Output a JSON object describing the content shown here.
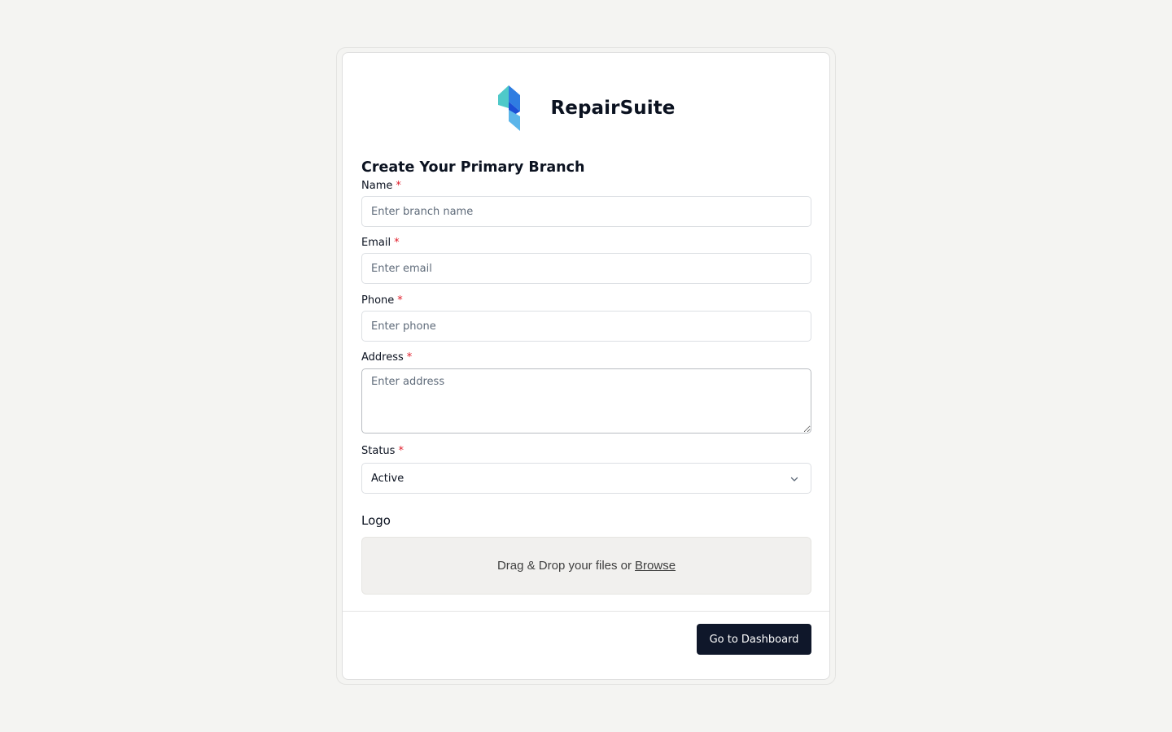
{
  "brand": {
    "name": "RepairSuite"
  },
  "form": {
    "title": "Create Your Primary Branch",
    "required_marker": "*",
    "fields": {
      "name": {
        "label": "Name",
        "placeholder": "Enter branch name",
        "value": ""
      },
      "email": {
        "label": "Email",
        "placeholder": "Enter email",
        "value": ""
      },
      "phone": {
        "label": "Phone",
        "placeholder": "Enter phone",
        "value": ""
      },
      "address": {
        "label": "Address",
        "placeholder": "Enter address",
        "value": ""
      },
      "status": {
        "label": "Status",
        "selected": "Active"
      }
    },
    "logo": {
      "heading": "Logo",
      "dropzone_text": "Drag & Drop your files or",
      "browse_label": "Browse"
    }
  },
  "footer": {
    "primary_button": "Go to Dashboard"
  },
  "icons": {
    "brand": "repairsuite-logo-icon",
    "select": "chevron-down-icon"
  },
  "colors": {
    "page_background": "#f4f4f2",
    "required_marker": "#e11d2a",
    "primary_button": "#0f172a",
    "logo_teal": "#4fc9c9",
    "logo_blue": "#2f7de1",
    "logo_light_blue": "#5bb5ea"
  }
}
